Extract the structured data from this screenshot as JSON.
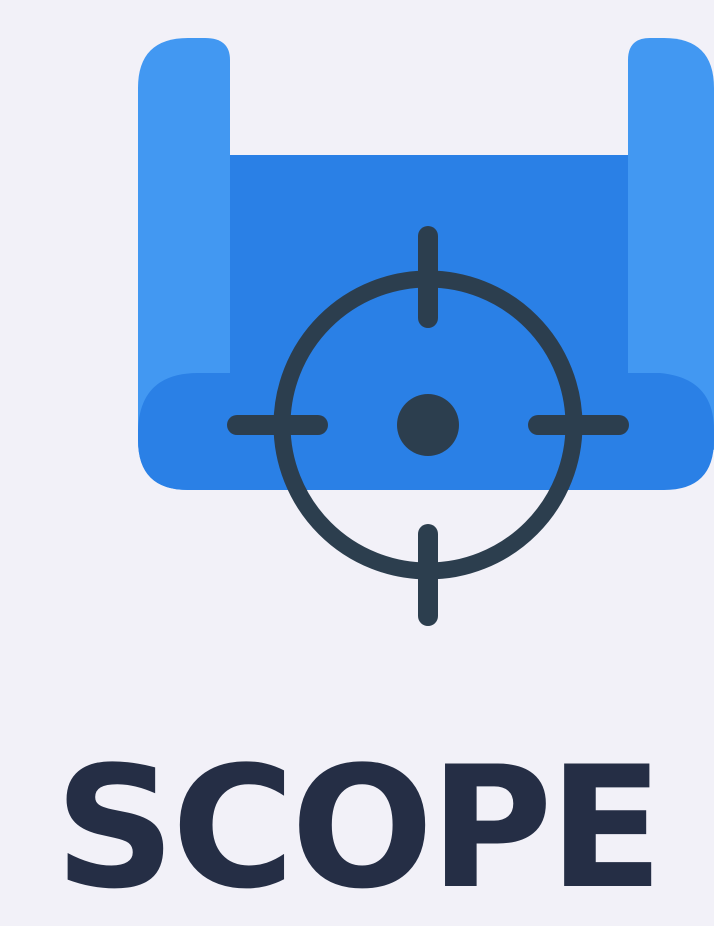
{
  "title": "SCOPE",
  "icon": {
    "name": "blueprint-crosshair-icon",
    "colors": {
      "scroll_front": "#2a80e6",
      "scroll_back": "#4298f2",
      "crosshair": "#2c3e4e"
    }
  },
  "colors": {
    "background": "#f2f1f8",
    "title": "#252e45"
  }
}
